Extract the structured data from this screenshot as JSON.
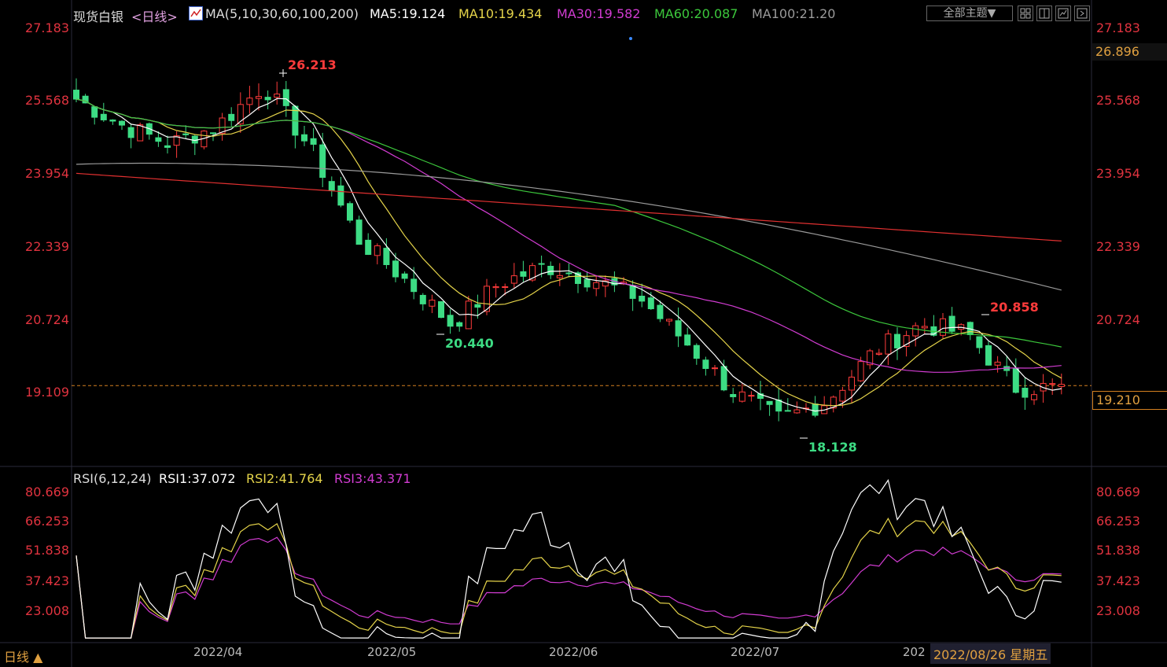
{
  "header": {
    "symbol": "现货白银",
    "period": "<日线>",
    "ma_label": "MA(5,10,30,60,100,200)",
    "ma5": "MA5:19.124",
    "ma10": "MA10:19.434",
    "ma30": "MA30:19.582",
    "ma60": "MA60:20.087",
    "ma100": "MA100:21.20",
    "theme_button": "全部主题▼"
  },
  "price_axis": [
    "27.183",
    "25.568",
    "23.954",
    "22.339",
    "20.724",
    "19.109"
  ],
  "price_axis_right": [
    "27.183",
    "25.568",
    "23.954",
    "22.339",
    "20.724"
  ],
  "top_right_value": "26.896",
  "current_price": "19.210",
  "annotations": {
    "high1": "26.213",
    "low1": "20.440",
    "low2": "18.128",
    "high2": "20.858"
  },
  "rsi": {
    "label": "RSI(6,12,24)",
    "rsi1": "RSI1:37.072",
    "rsi2": "RSI2:41.764",
    "rsi3": "RSI3:43.371",
    "axis": [
      "80.669",
      "66.253",
      "51.838",
      "37.423",
      "23.008"
    ]
  },
  "x_axis": [
    "2022/04",
    "2022/05",
    "2022/06",
    "2022/07",
    "202"
  ],
  "cursor_date": "2022/08/26 星期五",
  "bottom_left": "日线 ▲",
  "colors": {
    "up": "#ff3b3b",
    "down": "#3ddc84",
    "ma5": "#ffffff",
    "ma10": "#e5d44a",
    "ma30": "#d23cd2",
    "ma60": "#3cc83c",
    "ma100": "#9a9a9a",
    "ma200": "#e03030"
  },
  "chart_data": {
    "type": "candlestick",
    "x": [
      "2022/04",
      "2022/05",
      "2022/06",
      "2022/07",
      "2022/08"
    ],
    "ylim": [
      17.6,
      27.6
    ],
    "close_anchors": [
      25.6,
      25.0,
      24.6,
      25.0,
      25.9,
      24.5,
      22.5,
      21.6,
      20.6,
      21.5,
      21.9,
      21.6,
      21.2,
      20.2,
      19.1,
      18.5,
      18.9,
      20.0,
      20.6,
      20.4,
      19.2,
      19.2
    ],
    "markers": {
      "high": [
        26.213,
        20.858
      ],
      "low": [
        20.44,
        18.128
      ]
    },
    "current_price": 19.21,
    "ma": {
      "MA5": 19.124,
      "MA10": 19.434,
      "MA30": 19.582,
      "MA60": 20.087,
      "MA100": 21.2
    },
    "rsi": {
      "RSI1": 37.072,
      "RSI2": 41.764,
      "RSI3": 43.371,
      "ylim": [
        8,
        92
      ]
    }
  }
}
